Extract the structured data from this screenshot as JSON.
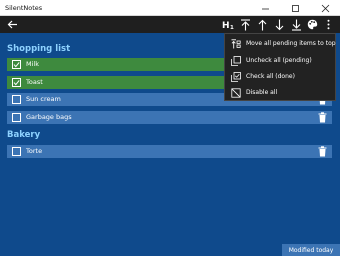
{
  "window": {
    "title": "SilentNotes"
  },
  "toolbar": {
    "back_icon": "arrow-left-icon",
    "icons": [
      "h1-icon",
      "move-to-top-icon",
      "move-up-icon",
      "move-down-icon",
      "move-to-bottom-icon",
      "palette-icon",
      "more-vertical-icon"
    ]
  },
  "lists": [
    {
      "title": "Shopping list",
      "items": [
        {
          "label": "Milk",
          "checked": true
        },
        {
          "label": "Toast",
          "checked": true
        },
        {
          "label": "Sun cream",
          "checked": false
        },
        {
          "label": "Garbage bags",
          "checked": false
        }
      ]
    },
    {
      "title": "Bakery",
      "items": [
        {
          "label": "Torte",
          "checked": false
        }
      ]
    }
  ],
  "menu": {
    "items": [
      {
        "label": "Move all pending items to top",
        "icon": "move-pending-top-icon"
      },
      {
        "label": "Uncheck all (pending)",
        "icon": "uncheck-all-icon"
      },
      {
        "label": "Check all (done)",
        "icon": "check-all-icon"
      },
      {
        "label": "Disable all",
        "icon": "disable-all-icon"
      }
    ]
  },
  "status": {
    "text": "Modified today"
  },
  "colors": {
    "background": "#0f4a8c",
    "heading": "#8ed2ff",
    "checked_item": "#3e8a3e",
    "unchecked_item": "#3c74b4",
    "toolbar": "#1f1f1f",
    "menu": "#222222"
  }
}
